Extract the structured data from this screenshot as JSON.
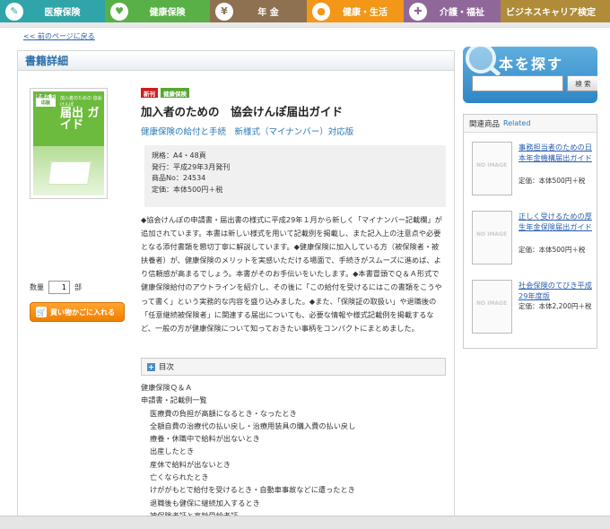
{
  "nav": {
    "tabs": [
      {
        "label": "医療保険",
        "color": "#2fa5a9",
        "icon": "shield-icon",
        "glyph": "✎",
        "width": 117
      },
      {
        "label": "健康保険",
        "color": "#58b046",
        "icon": "heart-icon",
        "glyph": "♥",
        "width": 117
      },
      {
        "label": "年 金",
        "color": "#8e7150",
        "icon": "yen-icon",
        "glyph": "¥",
        "width": 108
      },
      {
        "label": "健康・生活",
        "color": "#f29718",
        "icon": "apple-icon",
        "glyph": "●",
        "width": 108
      },
      {
        "label": "介護・福祉",
        "color": "#8f6899",
        "icon": "care-icon",
        "glyph": "✚",
        "width": 108
      },
      {
        "label": "ビジネスキャリア検定",
        "color": "#b08b38",
        "icon": "",
        "glyph": "",
        "width": 122
      }
    ]
  },
  "back_link": "<< 前のページに戻る",
  "panel_title": "書籍詳細",
  "cover": {
    "tag": "新様式 対応版",
    "small": "加入者のための 協会けんぽ",
    "big": "届出 ガイド"
  },
  "badges": [
    {
      "label": "新刊",
      "color": "#cc1f1f"
    },
    {
      "label": "健康保険",
      "color": "#58a632"
    }
  ],
  "book": {
    "title": "加入者のための　協会けんぽ届出ガイド",
    "subtitle": "健康保険の給付と手続　新様式（マイナンバー）対応版",
    "spec": [
      "規格：A4・48頁",
      "発行：平成29年3月発刊",
      "商品No：24534",
      "定価：本体500円＋税"
    ],
    "description": "◆協会けんぽの申請書・届出書の様式に平成29年１月から新しく「マイナンバー記載欄」が追加されています。本書は新しい様式を用いて記載例を掲載し、また記入上の注意点や必要となる添付書類を懇切丁寧に解説しています。◆健康保険に加入している方（被保険者・被扶養者）が、健康保険のメリットを実感いただける場面で、手続きがスムーズに進めば、より信頼感が高まるでしょう。本書がそのお手伝いをいたします。◆本書冒頭でＱ＆Ａ形式で健康保険給付のアウトラインを紹介し、その後に「この給付を受けるにはこの書類をこうやって書く」という実務的な内容を盛り込みました。◆また、「保険証の取扱い」や退職後の「任意継続被保険者」に関連する届出についても、必要な情報や様式記載例を掲載するなど、一般の方が健康保険について知っておきたい事柄をコンパクトにまとめました。"
  },
  "quantity": {
    "label": "数量",
    "value": "1",
    "unit": "部"
  },
  "cart_button": "買い物かごに入れる",
  "toc": {
    "heading": "目次",
    "items": [
      {
        "text": "健康保険Ｑ＆Ａ",
        "indent": false
      },
      {
        "text": "申請書・記載例一覧",
        "indent": false
      },
      {
        "text": "医療費の負担が高額になるとき・なったとき",
        "indent": true
      },
      {
        "text": "全額自費の治療代の払い戻し・治療用装具の購入費の払い戻し",
        "indent": true
      },
      {
        "text": "療養・休職中で給料が出ないとき",
        "indent": true
      },
      {
        "text": "出産したとき",
        "indent": true
      },
      {
        "text": "産休で給料が出ないとき",
        "indent": true
      },
      {
        "text": "亡くなられたとき",
        "indent": true
      },
      {
        "text": "けががもとで給付を受けるとき・自動車事故などに遭ったとき",
        "indent": true
      },
      {
        "text": "退職後も健保に継続加入するとき",
        "indent": true
      },
      {
        "text": "被保険者証と高齢受給者証",
        "indent": true
      }
    ]
  },
  "search": {
    "title": "本を探す",
    "button": "検 索",
    "value": ""
  },
  "related": {
    "heading": "関連商品",
    "heading_en": "Related",
    "noimage": "NO IMAGE",
    "items": [
      {
        "title": "事務担当者のための日本年金機構届出ガイド",
        "price": "定価：本体500円＋税"
      },
      {
        "title": "正しく受けるための厚生年金保険届出ガイド",
        "price": "定価：本体500円＋税"
      },
      {
        "title": "社会保険のてびき平成29年度版",
        "price": "定価：本体2,200円＋税"
      }
    ]
  }
}
